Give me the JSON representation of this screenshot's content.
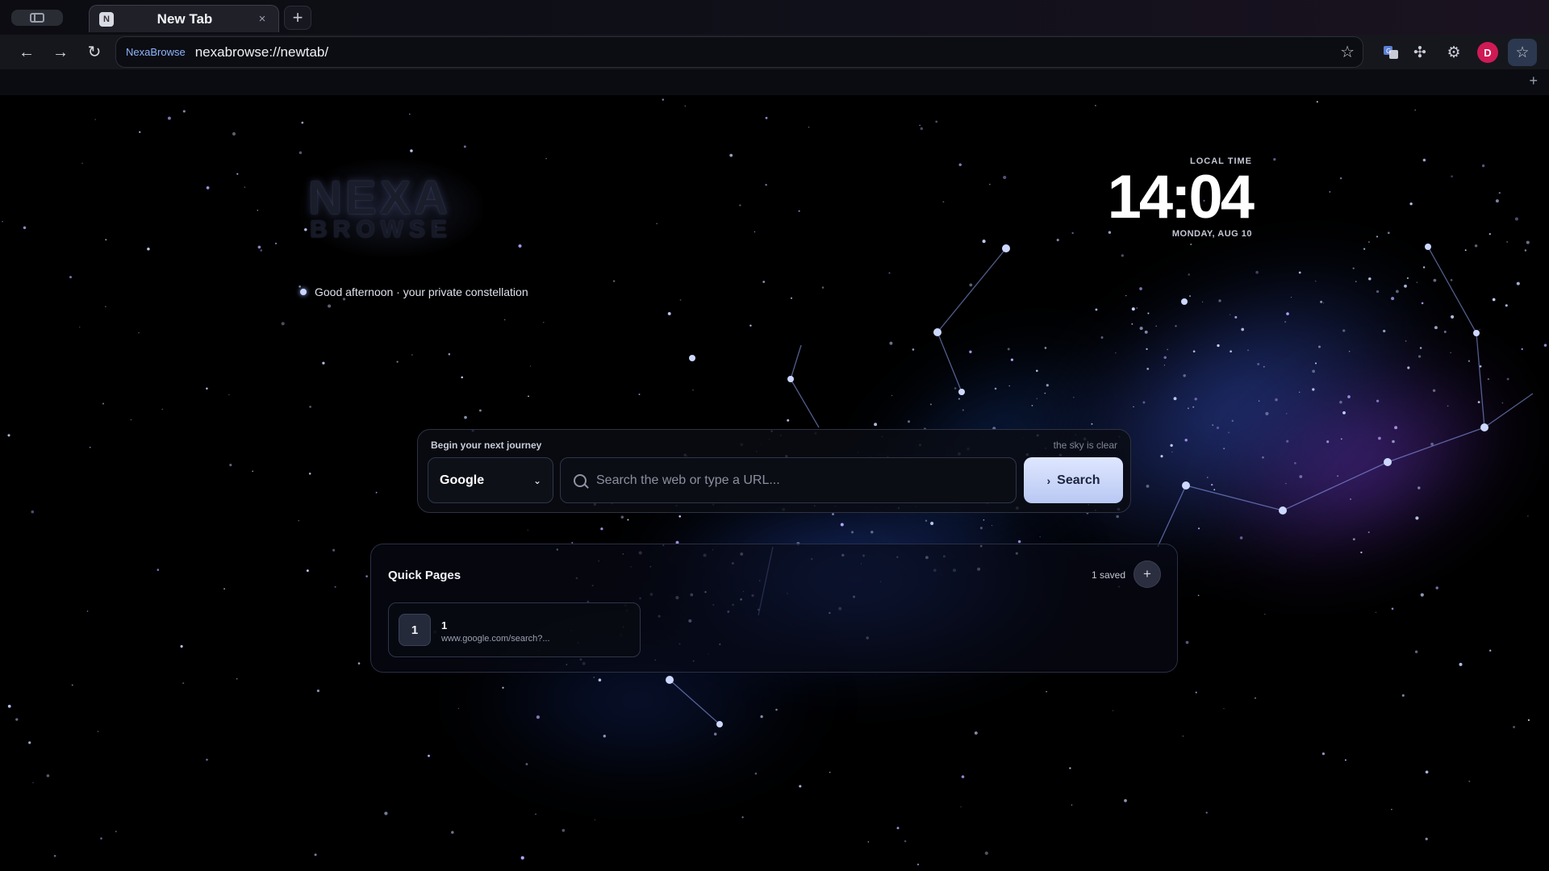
{
  "tabstrip": {
    "active_tab": {
      "title": "New Tab",
      "favicon": "N",
      "close": "×"
    },
    "new_tab": "+"
  },
  "toolbar": {
    "back_icon": "←",
    "forward_icon": "→",
    "reload_icon": "↻",
    "omnibox": {
      "badge": "NexaBrowse",
      "url": "nexabrowse://newtab/"
    },
    "profile_initial": "D"
  },
  "bookmarks_bar": {
    "add": "+"
  },
  "page": {
    "logo": {
      "line1": "NEXA",
      "line2": "BROWSE"
    },
    "greeting": "Good afternoon · your private constellation",
    "clock": {
      "label": "LOCAL TIME",
      "time": "14:04",
      "date": "MONDAY, AUG 10"
    },
    "search": {
      "heading": "Begin your next journey",
      "status": "the sky is clear",
      "engine": "Google",
      "placeholder": "Search the web or type a URL...",
      "button": "Search"
    },
    "quick_pages": {
      "title": "Quick Pages",
      "count": "1 saved",
      "add": "+",
      "items": [
        {
          "badge": "1",
          "name": "1",
          "url": "www.google.com/search?..."
        }
      ]
    }
  },
  "colors": {
    "accent": "#b9c8f3",
    "avatar": "#d01a55",
    "background": "#000000"
  }
}
